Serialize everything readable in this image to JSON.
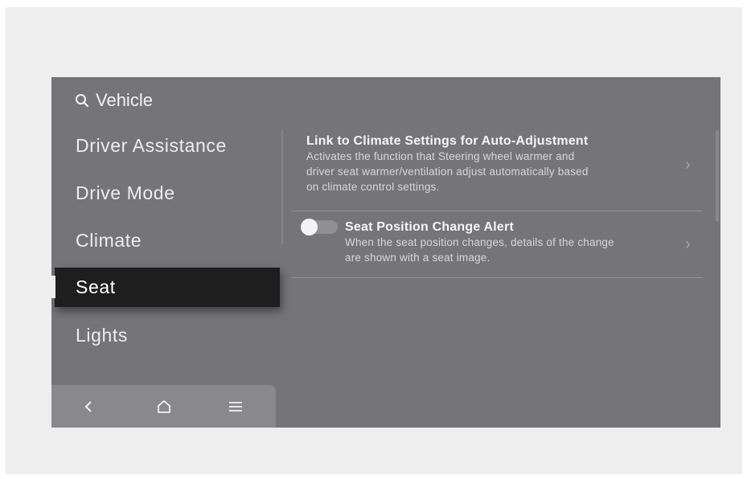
{
  "search": {
    "label": "Vehicle"
  },
  "menu": {
    "items": [
      {
        "label": "Driver Assistance"
      },
      {
        "label": "Drive Mode"
      },
      {
        "label": "Climate"
      },
      {
        "label": "Seat",
        "selected": true
      },
      {
        "label": "Lights"
      }
    ]
  },
  "bottom_nav": {
    "items": [
      {
        "icon": "back-icon",
        "glyph": "<"
      },
      {
        "icon": "home-icon"
      },
      {
        "icon": "menu-icon",
        "glyph": "≡"
      }
    ]
  },
  "settings": [
    {
      "title": "Link to Climate Settings for Auto-Adjustment",
      "description_lines": [
        "Activates the function that Steering wheel warmer and",
        "driver seat warmer/ventilation adjust automatically based",
        "on climate control settings."
      ],
      "has_toggle": false
    },
    {
      "title": "Seat Position Change Alert",
      "description_lines": [
        "When the seat position changes, details of the change",
        "are shown with a seat image."
      ],
      "has_toggle": true,
      "toggle_on": false
    }
  ],
  "colors": {
    "screen_bg": "#757577",
    "selected_bg": "#1e1e1f",
    "bottom_bar_bg": "#89898c"
  }
}
